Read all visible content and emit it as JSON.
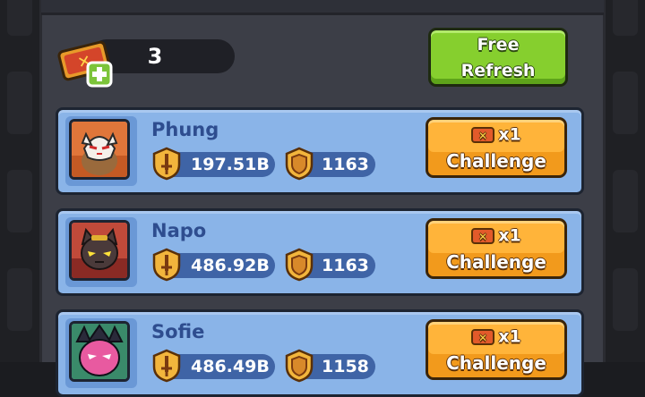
{
  "tickets": {
    "count": "3",
    "icon": "ticket-plus-icon"
  },
  "refresh_button": {
    "line1": "Free",
    "line2": "Refresh"
  },
  "colors": {
    "refresh_green": "#86cf2e",
    "challenge_orange": "#ffb43a",
    "card_blue": "#8ab4e8",
    "stat_pill": "#3f64a6",
    "panel": "#3c3e47"
  },
  "opponents": [
    {
      "name": "Phung",
      "power": "197.51B",
      "rating": "1163",
      "cost": "x1",
      "action": "Challenge",
      "avatar": "masked-fox-avatar"
    },
    {
      "name": "Napo",
      "power": "486.92B",
      "rating": "1163",
      "cost": "x1",
      "action": "Challenge",
      "avatar": "dark-cat-avatar"
    },
    {
      "name": "Sofie",
      "power": "486.49B",
      "rating": "1158",
      "cost": "x1",
      "action": "Challenge",
      "avatar": "pink-dragon-avatar"
    }
  ]
}
